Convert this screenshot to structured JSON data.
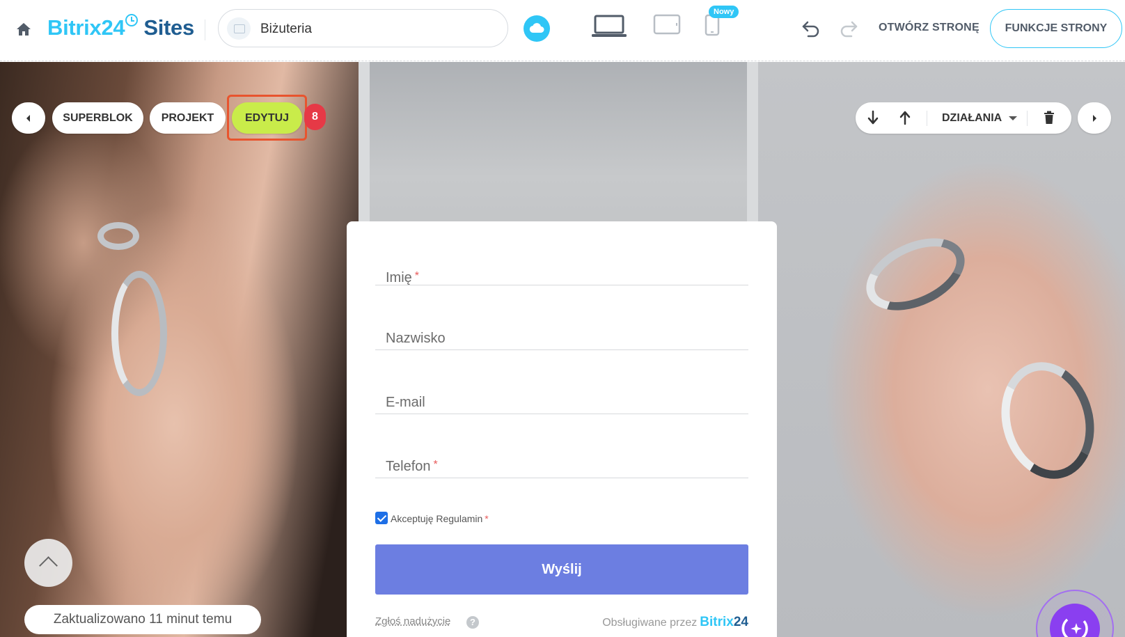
{
  "topbar": {
    "logo": {
      "brand": "Bitrix",
      "number": "24",
      "product": "Sites"
    },
    "site_name": "Biżuteria",
    "new_badge": "Nowy",
    "open_page": "OTWÓRZ STRONĘ",
    "page_features": "FUNKCJE STRONY"
  },
  "block_toolbar": {
    "superblok": "SUPERBLOK",
    "projekt": "PROJEKT",
    "edit": "EDYTUJ",
    "edit_count": "8",
    "actions": "DZIAŁANIA"
  },
  "form": {
    "fields": [
      {
        "label": "Imię",
        "required": "*"
      },
      {
        "label": "Nazwisko",
        "required": ""
      },
      {
        "label": "E-mail",
        "required": ""
      },
      {
        "label": "Telefon",
        "required": "*"
      }
    ],
    "consent_label": "Akceptuję Regulamin",
    "consent_required": "*",
    "submit_label": "Wyślij",
    "report_label": "Zgłoś nadużycie",
    "help_icon": "?",
    "powered_by": "Obsługiwane przez",
    "powered_brand": "Bitrix",
    "powered_number": "24"
  },
  "status": {
    "updated": "Zaktualizowano 11 minut temu"
  },
  "colors": {
    "accent": "#2fc6f6",
    "edit_button": "#c9ec4a",
    "submit": "#6c7ee1",
    "badge": "#e63946",
    "copilot": "#8a3ff0"
  }
}
